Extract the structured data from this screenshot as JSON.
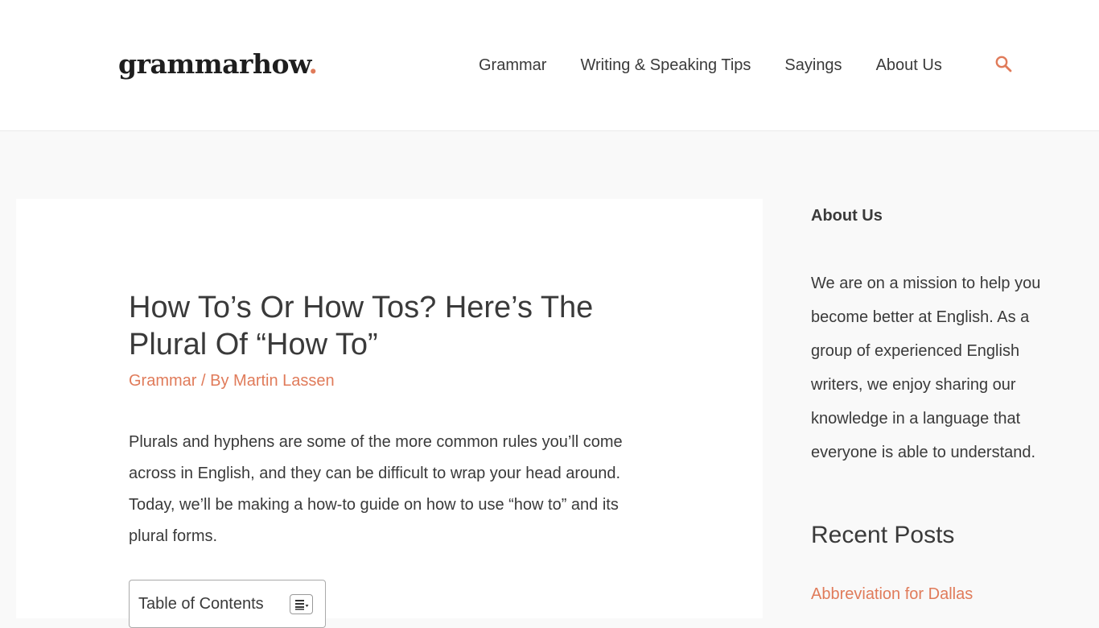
{
  "header": {
    "logo_text": "grammarhow",
    "logo_dot": ".",
    "nav": [
      {
        "label": "Grammar"
      },
      {
        "label": "Writing & Speaking Tips"
      },
      {
        "label": "Sayings"
      },
      {
        "label": "About Us"
      }
    ],
    "search_icon": "search-icon"
  },
  "article": {
    "title": "How To’s Or How Tos? Here’s The Plural Of “How To”",
    "meta": {
      "category": "Grammar",
      "separator": " / By ",
      "author": "Martin Lassen"
    },
    "intro": "Plurals and hyphens are some of the more common rules you’ll come across in English, and they can be difficult to wrap your head around. Today, we’ll be making a how-to guide on how to use “how to” and its plural forms.",
    "toc": {
      "title": "Table of Contents",
      "toggle_icon": "list-toggle-icon"
    }
  },
  "sidebar": {
    "about_title": "About Us",
    "about_text": "We are on a mission to help you become better at English. As a group of experienced English writers, we enjoy sharing our knowledge in a language that everyone is able to understand.",
    "recent_title": "Recent Posts",
    "recent_posts": [
      {
        "label": "Abbreviation for Dallas"
      }
    ]
  },
  "colors": {
    "accent": "#e07b5a",
    "text": "#3a3a3a",
    "page_bg": "#f9f9f9",
    "card_bg": "#ffffff"
  }
}
